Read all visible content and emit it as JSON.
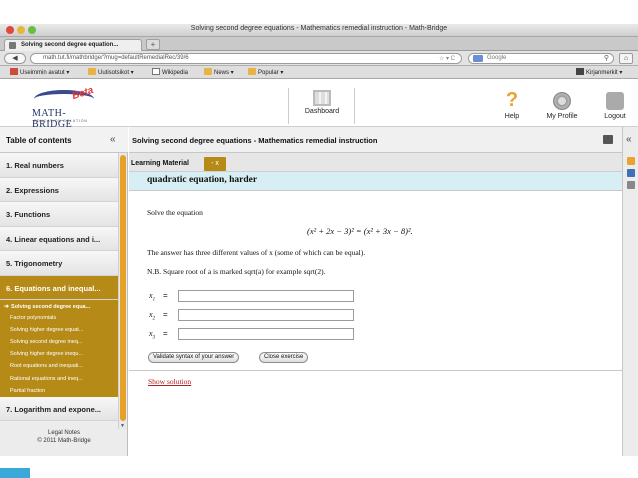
{
  "browser": {
    "window_title": "Solving second degree equations - Mathematics remedial instruction - Math-Bridge",
    "tab_label": "Solving second degree equation...",
    "new_tab": "+",
    "url": "math.tut.fi/mathbridge/?mug=defaultRemedialRec/39/6",
    "search_placeholder": "Google",
    "bookmarks": [
      "Useimmin avatut ▾",
      "Uutisotsikot ▾",
      "Wikipedia",
      "News ▾",
      "Popular ▾"
    ],
    "bookmarks_right": "Kirjanmerkit ▾"
  },
  "header": {
    "logo_text": "MATH-BRIDGE",
    "logo_sub": "EDUCATION SOLUTION",
    "logo_badge": "Beta",
    "dashboard": "Dashboard",
    "help": "Help",
    "profile": "My Profile",
    "logout": "Logout"
  },
  "sidebar": {
    "heading": "Table of contents",
    "collapse": "«",
    "items": [
      "1. Real numbers",
      "2. Expressions",
      "3. Functions",
      "4. Linear equations and i...",
      "5. Trigonometry",
      "6. Equations and inequal..."
    ],
    "subitems": [
      "Solving second degree equa...",
      "Factor polynomials",
      "Solving higher degree equat...",
      "Solving second degree ineq...",
      "Solving higher degree inequ...",
      "Root equations and inequali...",
      "Rational equations and ineq...",
      "Partial fraction"
    ],
    "after_item": "7. Logarithm and expone...",
    "footer_line1": "Legal Notes",
    "footer_line2": "© 2011 Math-Bridge"
  },
  "main": {
    "title": "Solving second degree equations - Mathematics remedial instruction",
    "tab_label": "Learning Material",
    "tab_close": "- x",
    "exercise_title": "quadratic equation, harder",
    "prompt": "Solve the equation",
    "equation": "(x² + 2x − 3)² = (x² + 3x − 8)².",
    "note1": "The answer has three different values of x (some of which can be equal).",
    "note2": "N.B. Square root of a is marked sqrt(a) for example sqrt(2).",
    "answers": [
      {
        "var": "x",
        "sub": "1",
        "eq": "="
      },
      {
        "var": "x",
        "sub": "2",
        "eq": "="
      },
      {
        "var": "x",
        "sub": "3",
        "eq": "="
      }
    ],
    "validate_button": "Validate syntax of your answer",
    "close_button": "Close exercise",
    "show_solution": "Show solution"
  },
  "rightrail": {
    "collapse": "«"
  }
}
